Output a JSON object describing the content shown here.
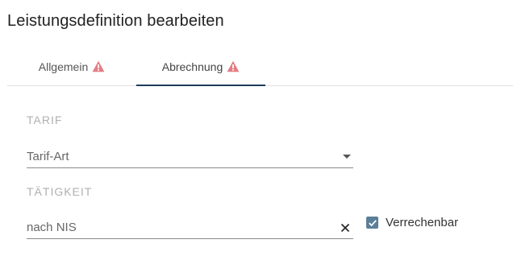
{
  "dialog": {
    "title": "Leistungsdefinition bearbeiten"
  },
  "tabs": [
    {
      "label": "Allgemein",
      "warning": true,
      "active": false
    },
    {
      "label": "Abrechnung",
      "warning": true,
      "active": true
    }
  ],
  "colors": {
    "warning": "#e57c83",
    "active_tab_indicator": "#1f3a5a",
    "checkbox": "#5a7f99"
  },
  "tarif": {
    "section_label": "TARIF",
    "field_value": "Tarif-Art",
    "icon": "dropdown-caret-icon"
  },
  "taetigkeit": {
    "section_label": "TÄTIGKEIT",
    "field_value": "nach NIS",
    "icon": "clear-icon"
  },
  "verrechenbar": {
    "label": "Verrechenbar",
    "checked": true
  }
}
